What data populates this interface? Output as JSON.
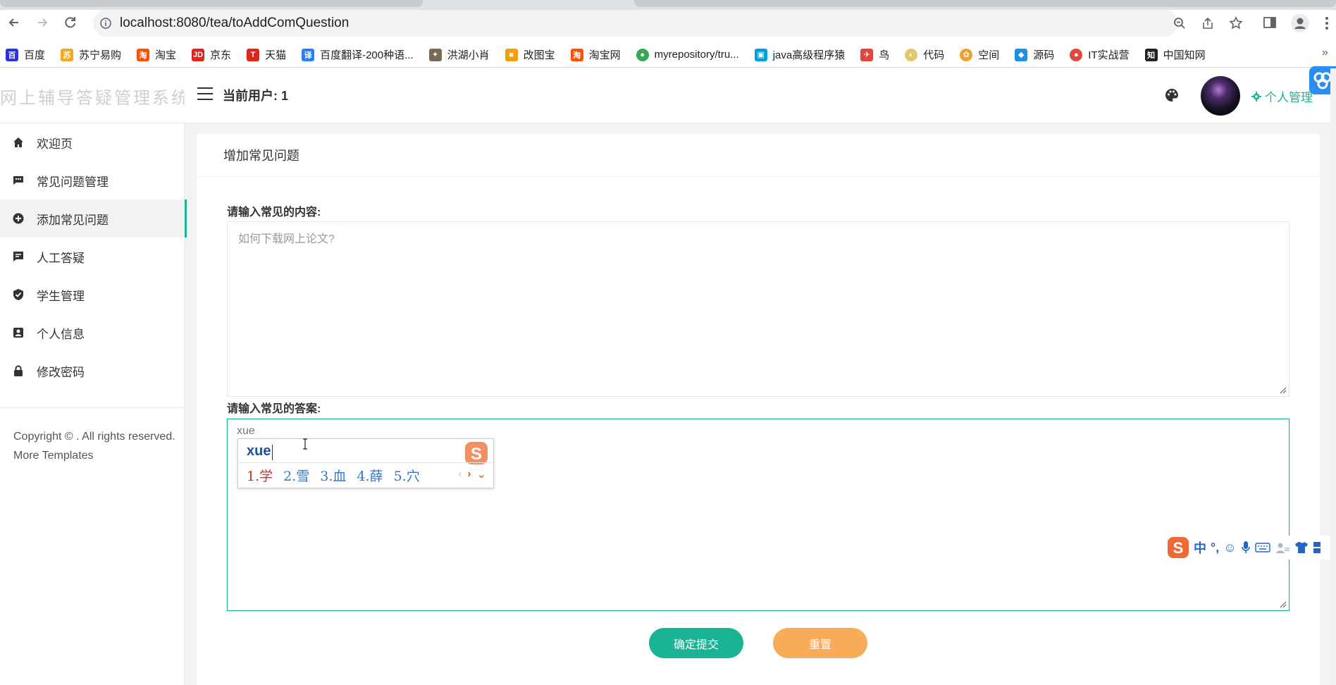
{
  "browser": {
    "url": "localhost:8080/tea/toAddComQuestion",
    "bookmarks": [
      {
        "label": "百度",
        "icon": "baidu-icon",
        "color": "#2932e1"
      },
      {
        "label": "苏宁易购",
        "icon": "suning-icon",
        "color": "#f5a623"
      },
      {
        "label": "淘宝",
        "icon": "taobao-icon",
        "color": "#ff5000"
      },
      {
        "label": "京东",
        "icon": "jd-icon",
        "color": "#e1251b"
      },
      {
        "label": "天猫",
        "icon": "tmall-icon",
        "color": "#e1251b"
      },
      {
        "label": "百度翻译-200种语...",
        "icon": "baidu-translate-icon",
        "color": "#2b7ef6"
      },
      {
        "label": "洪湖小肖",
        "icon": "bird-icon",
        "color": "#7a6a55"
      },
      {
        "label": "改图宝",
        "icon": "gaitubao-icon",
        "color": "#f59e0b"
      },
      {
        "label": "淘宝网",
        "icon": "taobao-net-icon",
        "color": "#ff5000"
      },
      {
        "label": "myrepository/tru...",
        "icon": "chrome-icon",
        "color": "#34a853"
      },
      {
        "label": "java高级程序猿",
        "icon": "bilibili-icon",
        "color": "#00a1d6"
      },
      {
        "label": "鸟",
        "icon": "swallow-icon",
        "color": "#e0483d"
      },
      {
        "label": "代码",
        "icon": "moon-icon",
        "color": "#e3c66e"
      },
      {
        "label": "空间",
        "icon": "space-icon",
        "color": "#f0a030"
      },
      {
        "label": "源码",
        "icon": "docker-icon",
        "color": "#1d91e6"
      },
      {
        "label": "IT实战营",
        "icon": "chrome-red-icon",
        "color": "#e0483d"
      },
      {
        "label": "中国知网",
        "icon": "cnki-icon",
        "color": "#222222"
      }
    ]
  },
  "header": {
    "logo": "网上辅导答疑管理系统",
    "current_user": "当前用户: 1",
    "personal_menu": "个人管理"
  },
  "sidebar": {
    "items": [
      {
        "label": "欢迎页",
        "icon": "home-icon",
        "active": false
      },
      {
        "label": "常见问题管理",
        "icon": "comment-icon",
        "active": false
      },
      {
        "label": "添加常见问题",
        "icon": "plus-circle-icon",
        "active": true
      },
      {
        "label": "人工答疑",
        "icon": "message-icon",
        "active": false
      },
      {
        "label": "学生管理",
        "icon": "shield-check-icon",
        "active": false
      },
      {
        "label": "个人信息",
        "icon": "contact-card-icon",
        "active": false
      },
      {
        "label": "修改密码",
        "icon": "lock-icon",
        "active": false
      }
    ],
    "copyright": "Copyright © . All rights reserved. More Templates"
  },
  "main": {
    "title": "增加常见问题",
    "content_label": "请输入常见的内容:",
    "content_placeholder": "如何下载网上论文?",
    "answer_label": "请输入常见的答案:",
    "answer_value": "xue",
    "submit_label": "确定提交",
    "reset_label": "重置"
  },
  "ime": {
    "composition": "xue",
    "candidates": [
      "1.学",
      "2.雪",
      "3.血",
      "4.薛",
      "5.穴"
    ],
    "status_mode": "中"
  },
  "colors": {
    "accent": "#1ab394",
    "warning": "#f8ac59"
  }
}
